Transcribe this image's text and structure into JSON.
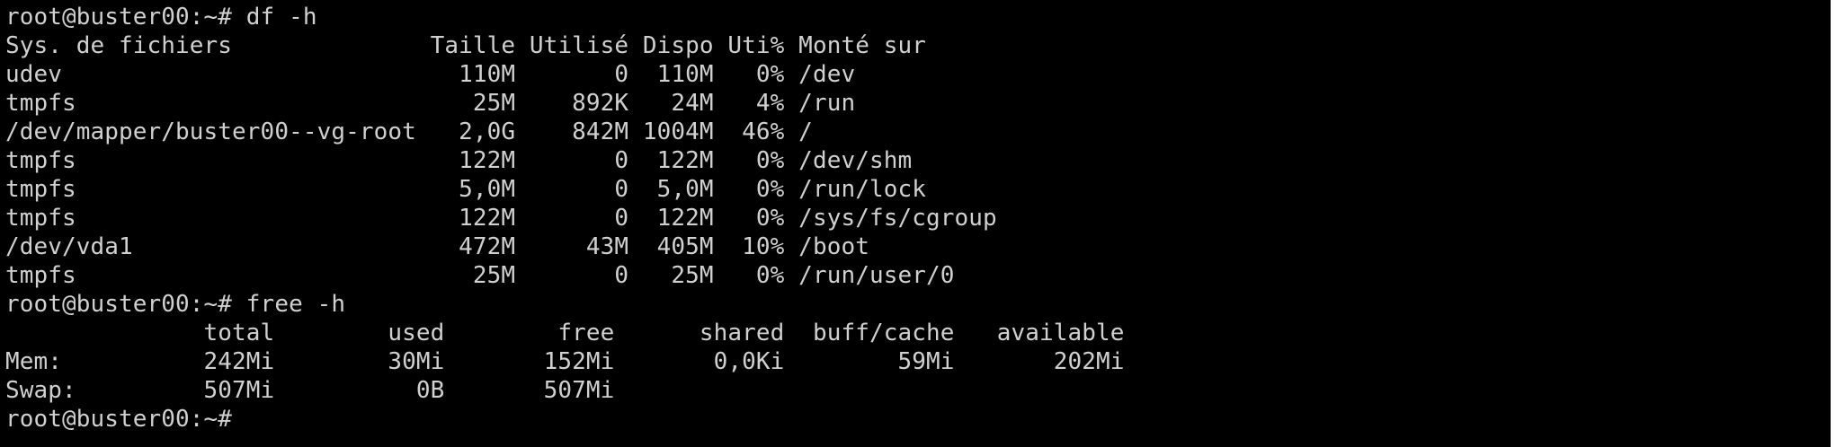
{
  "terminal": {
    "background": "#000000",
    "foreground": "#d0d0d0",
    "lines": [
      "root@buster00:~# df -h",
      "Sys. de fichiers              Taille Utilisé Dispo Uti% Monté sur",
      "udev                            110M       0  110M   0% /dev",
      "tmpfs                            25M    892K   24M   4% /run",
      "/dev/mapper/buster00--vg-root   2,0G    842M 1004M  46% /",
      "tmpfs                           122M       0  122M   0% /dev/shm",
      "tmpfs                           5,0M       0  5,0M   0% /run/lock",
      "tmpfs                           122M       0  122M   0% /sys/fs/cgroup",
      "/dev/vda1                       472M     43M  405M  10% /boot",
      "tmpfs                            25M       0   25M   0% /run/user/0",
      "root@buster00:~# free -h",
      "              total        used        free      shared  buff/cache   available",
      "Mem:          242Mi        30Mi       152Mi       0,0Ki        59Mi       202Mi",
      "Swap:         507Mi          0B       507Mi",
      "root@buster00:~# "
    ]
  }
}
